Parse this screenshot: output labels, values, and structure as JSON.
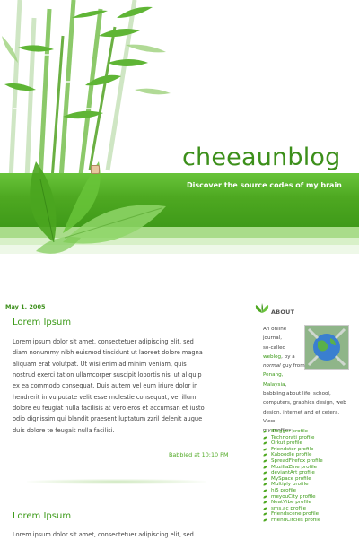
{
  "header": {
    "title": "cheeaunblog",
    "tagline": "Discover the source codes of my brain"
  },
  "posts": [
    {
      "date": "May 1, 2005",
      "title": "Lorem Ipsum",
      "body_lines": [
        "Lorem ipsum dolor sit amet, consectetuer adipiscing elit, sed",
        "diam nonummy nibh euismod tincidunt ut laoreet dolore magna",
        "aliquam erat volutpat. Ut wisi enim ad minim veniam, quis",
        "nostrud exerci tation ullamcorper suscipit lobortis nisl ut aliquip",
        "ex ea commodo consequat. Duis autem vel eum iriure dolor in",
        "hendrerit in vulputate velit esse molestie consequat, vel illum",
        "dolore eu feugiat nulla facilisis at vero eros et accumsan et iusto",
        "odio dignissim qui blandit praesent luptatum zzril delenit augue",
        "duis dolore te feugait nulla facilisi."
      ],
      "footer": "Babbled at 10:10 PM"
    },
    {
      "title": "Lorem Ipsum",
      "body_lines": [
        "Lorem ipsum dolor sit amet, consectetuer adipiscing elit, sed"
      ]
    }
  ],
  "sidebar": {
    "heading": "ABOUT",
    "about": {
      "l1": "An online",
      "l2": "journal,",
      "l3": "so-called",
      "link_weblog": "weblog",
      "l4_rest": ", by a",
      "normal": "normal",
      "l5_rest": " guy from",
      "link_penang": "Penang,",
      "link_malaysia": "Malaysia",
      "l7_rest": ",",
      "l8": "babbling about life, school,",
      "l9": "computers, graphics design, web",
      "l10": "design, internet and et cetera. View",
      "l11": "my profiles:"
    },
    "profiles": [
      "Blogger profile",
      "Technorati profile",
      "Orkut profile",
      "Friendster profile",
      "Kaboodle profile",
      "SpreadFirefox profile",
      "MozillaZine profile",
      "deviantArt profile",
      "MySpace profile",
      "Multiply profile",
      "hi5 profile",
      "meyouCity profile",
      "NeatVibe profile",
      "sms.ac profile",
      "Friendscene profile",
      "FriendCircles profile"
    ]
  },
  "colors": {
    "accent_green": "#3c9a18",
    "band_green": "#4ea821"
  }
}
